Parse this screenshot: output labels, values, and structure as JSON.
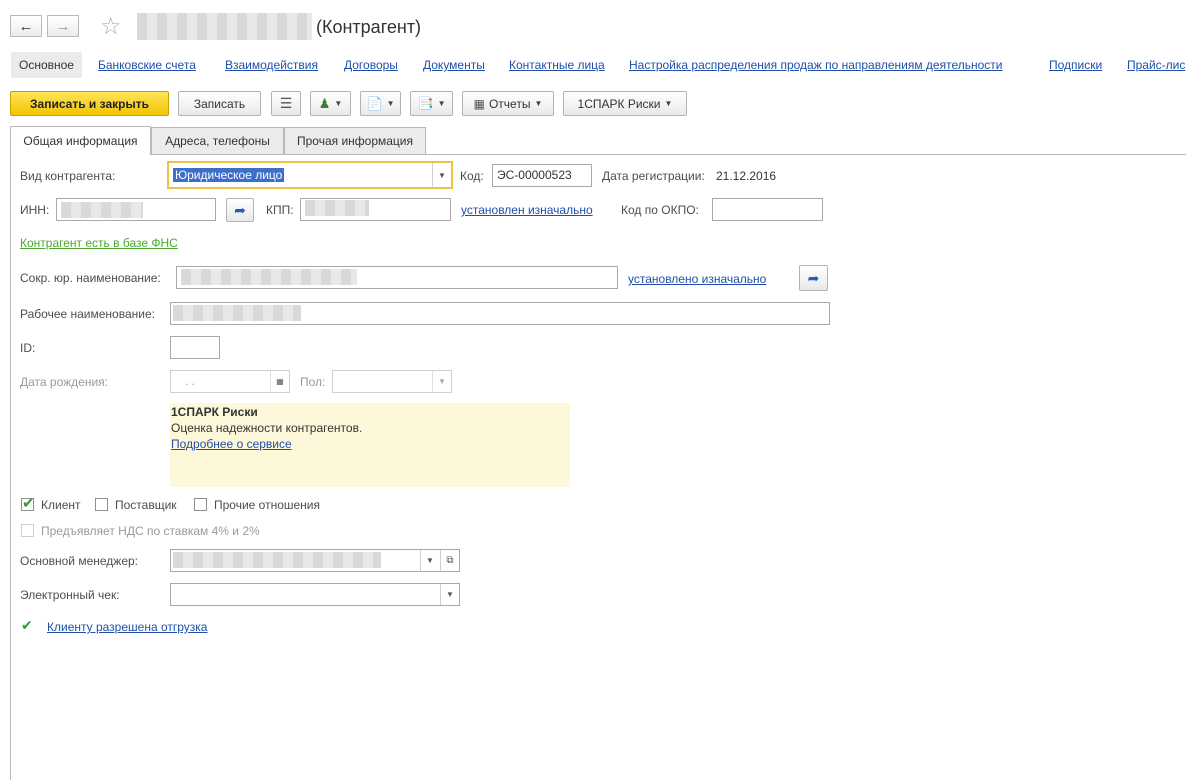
{
  "window": {
    "title": "(Контрагент)"
  },
  "nav": {
    "links": [
      {
        "label": "Основное"
      },
      {
        "label": "Банковские счета"
      },
      {
        "label": "Взаимодействия"
      },
      {
        "label": "Договоры"
      },
      {
        "label": "Документы"
      },
      {
        "label": "Контактные лица"
      },
      {
        "label": "Настройка распределения продаж по направлениям деятельности"
      },
      {
        "label": "Подписки"
      },
      {
        "label": "Прайс-лис"
      }
    ]
  },
  "toolbar": {
    "save_close": "Записать и закрыть",
    "save": "Записать",
    "reports": "Отчеты",
    "spark": "1СПАРК Риски"
  },
  "tabs": [
    {
      "label": "Общая информация"
    },
    {
      "label": "Адреса, телефоны"
    },
    {
      "label": "Прочая информация"
    }
  ],
  "form": {
    "kind_label": "Вид контрагента:",
    "kind_value": "Юридическое лицо",
    "code_label": "Код:",
    "code_value": "ЭС-00000523",
    "regdate_label": "Дата регистрации:",
    "regdate_value": "21.12.2016",
    "inn_label": "ИНН:",
    "kpp_label": "КПП:",
    "kpp_link": "установлен изначально",
    "okpo_label": "Код по ОКПО:",
    "fns_link": "Контрагент есть в базе ФНС",
    "short_name_label": "Сокр. юр. наименование:",
    "short_name_link": "установлено изначально",
    "work_name_label": "Рабочее наименование:",
    "id_label": "ID:",
    "birth_label": "Дата рождения:",
    "birth_value": ".  .",
    "gender_label": "Пол:",
    "spark_title": "1СПАРК Риски",
    "spark_desc": "Оценка надежности контрагентов.",
    "spark_link": "Подробнее о сервисе",
    "client_label": "Клиент",
    "supplier_label": "Поставщик",
    "other_label": "Прочие отношения",
    "vat_label": "Предъявляет НДС по ставкам 4% и 2%",
    "manager_label": "Основной менеджер:",
    "echeck_label": "Электронный чек:",
    "shipment_link": "Клиенту разрешена отгрузка"
  },
  "colors": {
    "accent_yellow": "#f3c400",
    "link_blue": "#1f4fa8",
    "link_green": "#4aa82b",
    "info_bg": "#fdf8d9"
  }
}
